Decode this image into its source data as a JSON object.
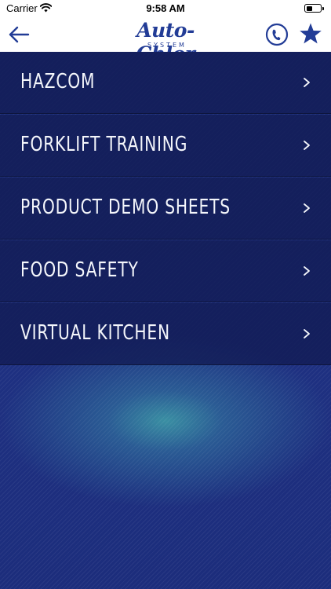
{
  "status_bar": {
    "carrier": "Carrier",
    "time": "9:58 AM",
    "battery_level": 0.45
  },
  "nav": {
    "logo_text": "Auto-Chlor",
    "logo_subtext": "SYSTEM",
    "back_icon": "arrow-left-icon",
    "phone_icon": "phone-icon",
    "star_icon": "star-icon"
  },
  "colors": {
    "brand_blue": "#223c96",
    "background_navy": "#1e3081",
    "menu_text": "#f4f6fb",
    "glow_teal": "#3a8fa3"
  },
  "menu": {
    "items": [
      {
        "label": "HAZCOM"
      },
      {
        "label": "FORKLIFT TRAINING"
      },
      {
        "label": "PRODUCT DEMO SHEETS"
      },
      {
        "label": "FOOD SAFETY"
      },
      {
        "label": "VIRTUAL KITCHEN"
      }
    ],
    "chevron": ">"
  }
}
